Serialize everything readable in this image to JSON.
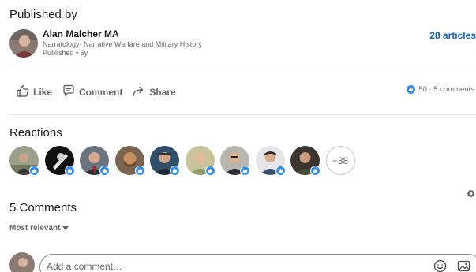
{
  "publisher": {
    "heading": "Published by",
    "name": "Alan Malcher MA",
    "headline": "Narratology- Narrative Warfare and Military History",
    "published": "Published • 5y",
    "articles_link": "28 articles"
  },
  "actions": {
    "like": "Like",
    "comment": "Comment",
    "share": "Share"
  },
  "social_counts": "50 · 5 comments",
  "reactions": {
    "heading": "Reactions",
    "more": "+38"
  },
  "comments": {
    "heading": "5 Comments",
    "sort": "Most relevant",
    "placeholder": "Add a comment…"
  },
  "colors": {
    "link": "#0a66c2",
    "like_blue": "#378fe9"
  },
  "icons": [
    "like-icon",
    "comment-icon",
    "share-icon",
    "like-reaction-icon",
    "settings-icon",
    "emoji-icon",
    "image-icon"
  ]
}
